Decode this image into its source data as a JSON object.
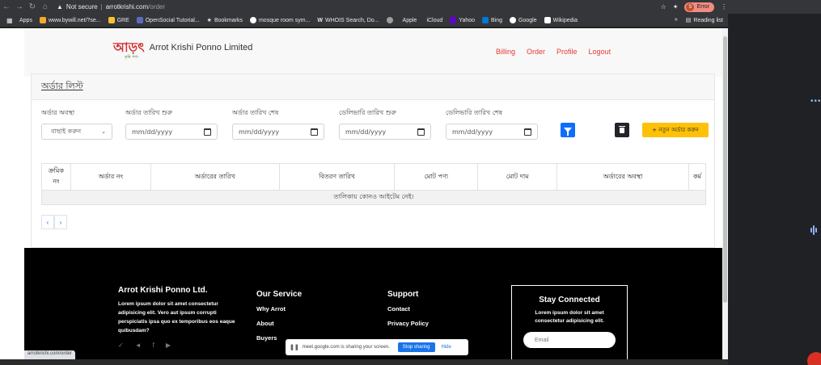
{
  "browser": {
    "security_label": "Not secure",
    "url_host": "arrotkrishi.com",
    "url_path": "/order",
    "profile_label": "Error",
    "profile_initial": "S"
  },
  "bookmarks": {
    "items": [
      "Apps",
      "www.bywill.net/?se...",
      "GRE",
      "OpenSocial Tutorial...",
      "Bookmarks",
      "mosque room sym...",
      "WHOIS Search, Do...",
      "Apple",
      "iCloud",
      "Yahoo",
      "Bing",
      "Google",
      "Wikipedia"
    ],
    "overflow": "»",
    "reading_list": "Reading list"
  },
  "site": {
    "logo_text": "আড়ৎ",
    "logo_sub": "কৃষি পণ্য",
    "brand": "Arrot Krishi Ponno Limited",
    "nav": [
      "Billing",
      "Order",
      "Profile",
      "Logout"
    ]
  },
  "order_list": {
    "title": "অর্ডার লিস্ট",
    "filters": {
      "status_label": "অর্ডার অবস্থা",
      "status_value": "বাছাই করুন",
      "order_start_label": "অর্ডার তারিখ শুরু",
      "order_end_label": "অর্ডার তারিখ শেষ",
      "delivery_start_label": "ডেলিভারি তারিখ শুরু",
      "delivery_end_label": "ডেলিভারি তারিখ শেষ",
      "date_placeholder": "mm/dd/yyyy"
    },
    "add_button": "+ নতুন অর্ডার করুন",
    "table": {
      "headers": [
        "ক্রমিক নং",
        "অর্ডার নং",
        "অর্ডারের তারিখ",
        "বিতরণ তারিখ",
        "মোট পণ্য",
        "মোট দাম",
        "অর্ডারের অবস্থা",
        "কর্ম"
      ],
      "empty_message": "তালিকায় কোনও আইটেম নেই।"
    },
    "pager": {
      "prev": "‹",
      "next": "›"
    }
  },
  "footer": {
    "company_title": "Arrot Krishi Ponno Ltd.",
    "company_text": "Lorem ipsum dolor sit amet consectetur adipisicing elit. Vero aut ipsum corrupti perspiciatis ipsa quo ex temporibus eos eaque quibusdam?",
    "service_title": "Our Service",
    "service_links": [
      "Why Arrot",
      "About",
      "Buyers"
    ],
    "support_title": "Support",
    "support_links": [
      "Contact",
      "Privacy Policy"
    ],
    "stay_title": "Stay Connected",
    "stay_text": "Lorem ipsum dolor sit amet consectetur adipisicing elit.",
    "email_placeholder": "Email"
  },
  "screen_share": {
    "message": "meet.google.com is sharing your screen.",
    "stop_label": "Stop sharing",
    "hide_label": "Hide"
  },
  "status_bar_url": "arrotkrishi.com/order",
  "colors": {
    "accent_red": "#e53935",
    "primary_blue": "#0d6efd",
    "warning_yellow": "#ffc107",
    "footer_bg": "#000000"
  }
}
